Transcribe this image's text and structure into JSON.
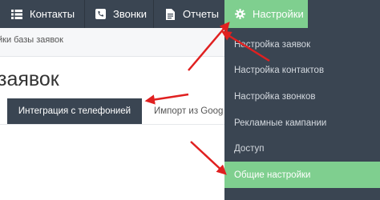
{
  "topnav": {
    "items": [
      {
        "label": "Контакты",
        "icon": "list-icon"
      },
      {
        "label": "Звонки",
        "icon": "phone-icon"
      },
      {
        "label": "Отчеты",
        "icon": "document-icon"
      },
      {
        "label": "Настройки",
        "icon": "gear-icon",
        "active": true
      }
    ]
  },
  "breadcrumb": "йки базы заявок",
  "page_title": "заявок",
  "tabs": [
    {
      "label": "Интеграция с телефонией",
      "active": true
    },
    {
      "label": "Импорт из Goog"
    }
  ],
  "settings_menu": {
    "items": [
      {
        "label": "Настройка заявок"
      },
      {
        "label": "Настройка контактов"
      },
      {
        "label": "Настройка звонков"
      },
      {
        "label": "Рекламные кампании"
      },
      {
        "label": "Доступ"
      },
      {
        "label": "Общие настройки",
        "active": true
      }
    ]
  },
  "colors": {
    "nav_bg": "#3a4552",
    "accent_green": "#7fcf8f",
    "annotation_red": "#e02020"
  }
}
